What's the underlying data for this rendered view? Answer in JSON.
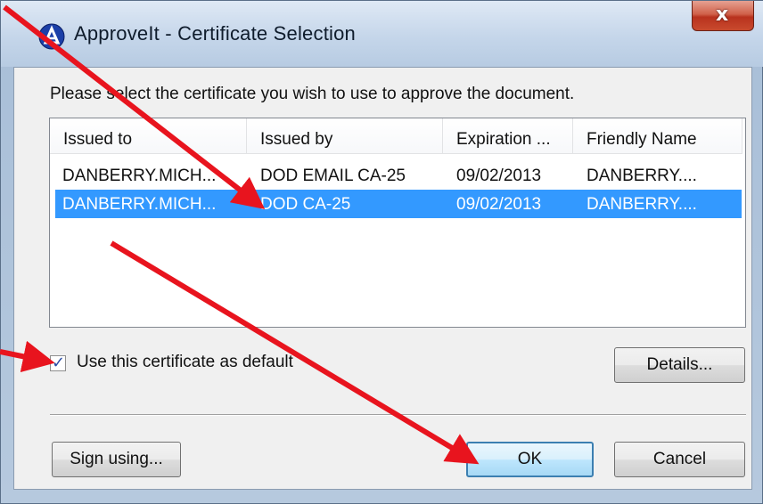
{
  "window": {
    "title": "ApproveIt - Certificate Selection",
    "close_glyph": "x"
  },
  "dialog": {
    "instruction": "Please select the certificate you wish to use to approve the document.",
    "columns": [
      "Issued to",
      "Issued by",
      "Expiration ...",
      "Friendly Name"
    ],
    "rows": [
      {
        "issued_to": "DANBERRY.MICH...",
        "issued_by": "DOD EMAIL CA-25",
        "expiration": "09/02/2013",
        "friendly_name": "DANBERRY....",
        "selected": false
      },
      {
        "issued_to": "DANBERRY.MICH...",
        "issued_by": "DOD CA-25",
        "expiration": "09/02/2013",
        "friendly_name": "DANBERRY....",
        "selected": true
      }
    ],
    "default_checkbox": {
      "label": "Use this certificate as default",
      "checked": true
    },
    "buttons": {
      "details": "Details...",
      "sign_using": "Sign using...",
      "ok": "OK",
      "cancel": "Cancel"
    }
  },
  "colors": {
    "selection": "#3399ff",
    "annotation_arrow": "#e8141e",
    "close_button": "#c94a2d"
  },
  "icons": {
    "app": "approveit-logo-icon",
    "close": "close-icon",
    "check": "checkmark-icon"
  }
}
